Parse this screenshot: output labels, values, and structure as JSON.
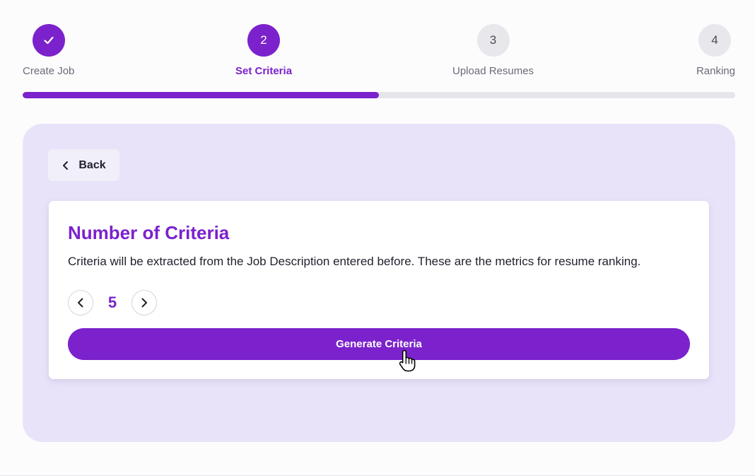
{
  "steps": [
    {
      "number": "1",
      "label": "Create Job",
      "state": "done",
      "icon": "check-icon"
    },
    {
      "number": "2",
      "label": "Set Criteria",
      "state": "current"
    },
    {
      "number": "3",
      "label": "Upload Resumes",
      "state": "todo"
    },
    {
      "number": "4",
      "label": "Ranking",
      "state": "todo"
    }
  ],
  "progress": {
    "percent": 50
  },
  "back": {
    "label": "Back",
    "icon": "chevron-left-icon"
  },
  "card": {
    "title": "Number of Criteria",
    "description": "Criteria will be extracted from the Job Description entered before. These are the metrics for resume ranking.",
    "count": "5",
    "decrement_icon": "chevron-left-icon",
    "increment_icon": "chevron-right-icon",
    "generate_label": "Generate Criteria"
  },
  "colors": {
    "accent": "#7b22cc",
    "panel_bg": "#e9e3fa",
    "inactive_step": "#e7e7ec"
  }
}
